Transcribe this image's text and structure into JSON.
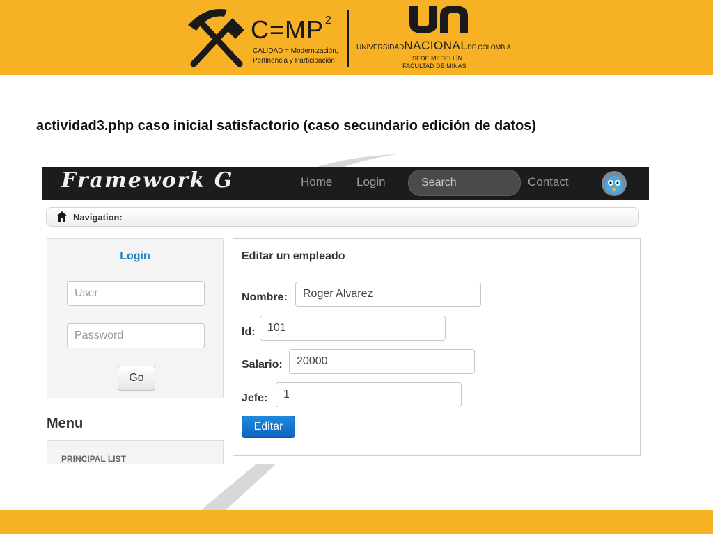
{
  "banner": {
    "cmp": {
      "title": "C=MP",
      "sup": "2",
      "subtitle_line1": "CALIDAD = Modernización,",
      "subtitle_line2": "Pertinencia y Participación",
      "icon": "crossed-tools-icon"
    },
    "un": {
      "mark": "un",
      "prefix": "UNIVERSIDAD",
      "name": "NACIONAL",
      "suffix": "DE COLOMBIA",
      "sede": "SEDE MEDELLÍN",
      "facultad": "FACULTAD DE MINAS"
    },
    "colors": {
      "banner": "#f6b124",
      "text": "#1a1a1a"
    }
  },
  "slide_title": "actividad3.php caso inicial satisfactorio (caso secundario edición de datos)",
  "app": {
    "brand": "Framework G",
    "nav": {
      "home": "Home",
      "login": "Login",
      "search_placeholder": "Search",
      "contact": "Contact",
      "avatar_icon": "bird-avatar-icon"
    },
    "breadcrumb": {
      "label": "Navigation:",
      "icon": "home-icon"
    },
    "login": {
      "title": "Login",
      "user_placeholder": "User",
      "password_placeholder": "Password",
      "go_label": "Go"
    },
    "menu": {
      "title": "Menu",
      "items": [
        "PRINCIPAL LIST"
      ]
    },
    "edit_form": {
      "title": "Editar un empleado",
      "fields": [
        {
          "label": "Nombre:",
          "value": "Roger Alvarez"
        },
        {
          "label": "Id:",
          "value": "101"
        },
        {
          "label": "Salario:",
          "value": "20000"
        },
        {
          "label": "Jefe:",
          "value": "1"
        }
      ],
      "submit_label": "Editar"
    },
    "colors": {
      "navbar": "#1c1c1c",
      "link_blue": "#1a82c4",
      "primary_button": "#0d63c0"
    }
  }
}
